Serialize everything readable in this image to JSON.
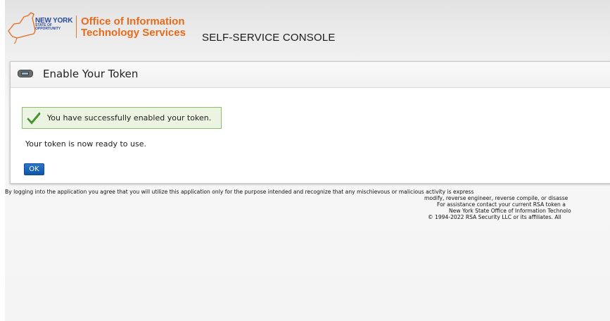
{
  "header": {
    "logo": {
      "state_line1": "NEW YORK",
      "state_line2": "STATE OF",
      "state_line3": "OPPORTUNITY",
      "office_line1": "Office of Information",
      "office_line2": "Technology Services"
    },
    "console_title": "SELF-SERVICE CONSOLE",
    "brand_color": "#e66c1c",
    "state_color": "#2b4a9b"
  },
  "panel": {
    "title": "Enable Your Token",
    "icon": "token-icon",
    "success_message": "You have successfully enabled your token.",
    "success_icon": "checkmark-icon",
    "ready_message": "Your token is now ready to use.",
    "ok_label": "OK",
    "ok_color": "#1565c0"
  },
  "footer": {
    "line1": "By logging into the application you agree that you will utilize this application only for the purpose intended and recognize that any mischievous or malicious activity is express",
    "line2": "modify, reverse engineer, reverse compile, or disasse",
    "line3": "For assistance contact your current RSA token a",
    "line4": "New York State Office of Information Technolo",
    "line5": "© 1994-2022 RSA Security LLC or its affiliates. All"
  }
}
